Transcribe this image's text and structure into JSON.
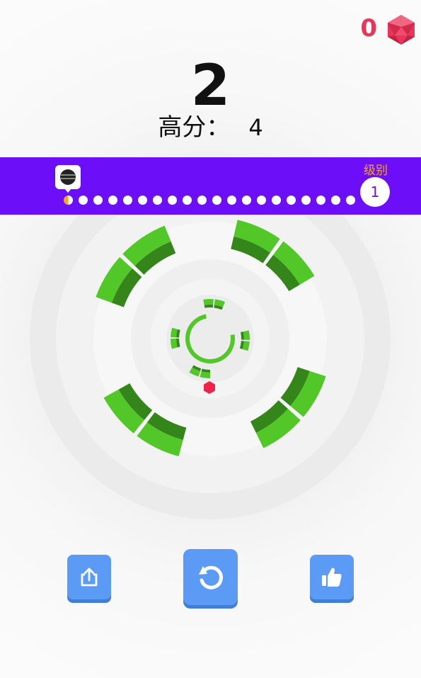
{
  "hud": {
    "gems": "0",
    "score": "2",
    "best_label": "高分：",
    "best_value": "4"
  },
  "progress": {
    "level_label": "级别",
    "level": "1",
    "dot_count": 20,
    "current_dot": 1,
    "bar_color": "#6d0ef9"
  },
  "buttons": {
    "share": "share-icon",
    "restart": "restart-icon",
    "like": "thumbs-up-icon"
  },
  "colors": {
    "block_green": "#52c828",
    "block_dark": "#34861b",
    "gem_red": "#e8365a",
    "button_blue": "#5b9bf6"
  }
}
